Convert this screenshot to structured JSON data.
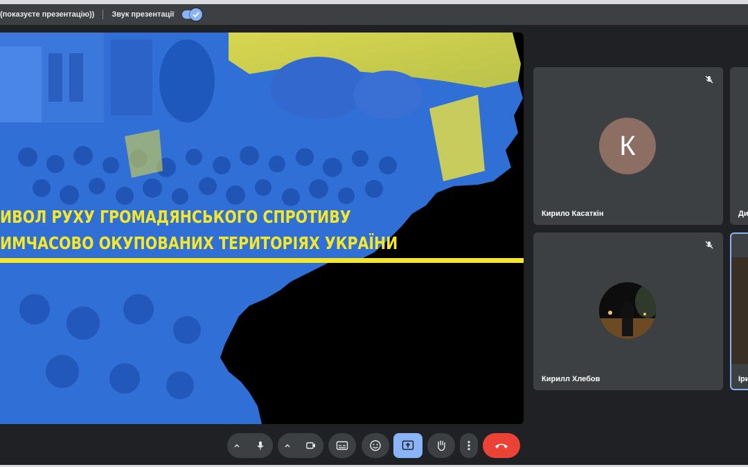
{
  "presentation_bar": {
    "presenting_text": "(показуєте презентацію))",
    "sound_label": "Звук презентації",
    "sound_enabled": true
  },
  "slide": {
    "line1": "ИВОЛ РУХУ ГРОМАДЯНСЬКОГО СПРОТИВУ",
    "line2": "ИМЧАСОВО ОКУПОВАНИХ ТЕРИТОРІЯХ УКРАЇНИ",
    "accent_yellow": "#f5e82a",
    "accent_blue": "#2f6fd6"
  },
  "participants": [
    {
      "name": "Кирило Касаткін",
      "avatar": "К",
      "avatar_color": "#8d6e63",
      "muted": true
    },
    {
      "name": "Ди",
      "muted": false
    },
    {
      "name": "Кирилл Хлебов",
      "avatar": "photo",
      "muted": true
    },
    {
      "name": "Іри",
      "muted": false
    }
  ],
  "controls": {
    "mic": "mic-icon",
    "camera": "camera-icon",
    "captions": "captions-icon",
    "reactions": "emoji-icon",
    "present": "present-icon",
    "raise_hand": "hand-icon",
    "more": "more-vert-icon",
    "leave": "phone-hangup-icon",
    "leave_color": "#ea4335",
    "present_color": "#8ab4f8"
  }
}
